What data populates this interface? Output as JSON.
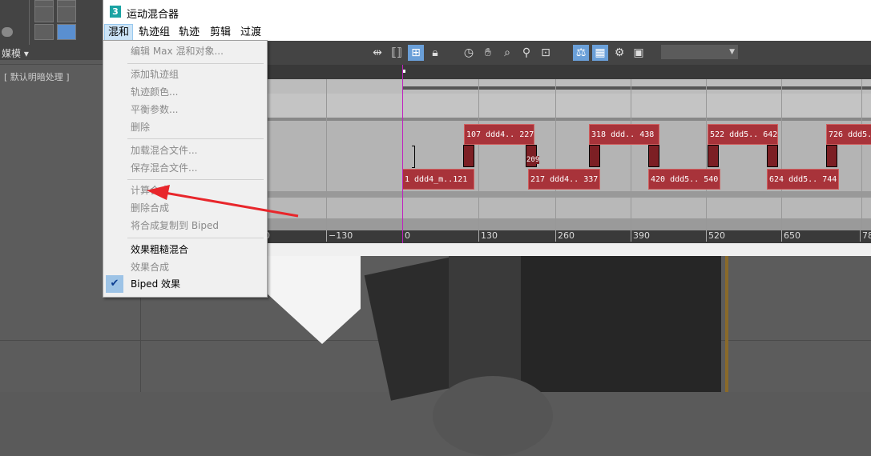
{
  "background": {
    "dropdown_label": "媒模",
    "viewport_label": "[ 默认明暗处理 ]"
  },
  "window": {
    "icon": "3",
    "title": "运动混合器"
  },
  "menubar": [
    "混和",
    "轨迹组",
    "轨迹",
    "剪辑",
    "过渡"
  ],
  "toolbar": {
    "icons": [
      "move-keys-icon",
      "fit-icon",
      "add-clip-icon",
      "lock-icon",
      "clock-icon",
      "hand-icon",
      "zoom-region-icon",
      "zoom-icon",
      "zoom-extents-icon",
      "balance-icon",
      "preview-icon",
      "settings-icon",
      "layout-icon"
    ],
    "combo_value": ""
  },
  "dropdown": {
    "items": [
      {
        "label": "编辑 Max 混和对象...",
        "enabled": false
      },
      {
        "label": "添加轨迹组",
        "enabled": false
      },
      {
        "label": "轨迹颜色...",
        "enabled": false
      },
      {
        "label": "平衡参数...",
        "enabled": false
      },
      {
        "label": "删除",
        "enabled": false
      },
      {
        "label": "加载混合文件...",
        "enabled": false
      },
      {
        "label": "保存混合文件...",
        "enabled": false
      },
      {
        "label": "计算合成",
        "enabled": false
      },
      {
        "label": "删除合成",
        "enabled": false
      },
      {
        "label": "将合成复制到 Biped",
        "enabled": false
      },
      {
        "label": "效果粗糙混合",
        "enabled": true
      },
      {
        "label": "效果合成",
        "enabled": false
      },
      {
        "label": "Biped 效果",
        "enabled": true,
        "checked": true
      }
    ]
  },
  "clips_top": [
    "107 ddd4.. 227",
    "318 ddd.. 438",
    "522 ddd5.. 642",
    "726 ddd5."
  ],
  "clips_bottom": [
    "1  ddd4_m..121",
    "217 ddd4.. 337",
    "420 ddd5.. 540",
    "624 ddd5.. 744"
  ],
  "transition_label": "209",
  "ruler": [
    "0",
    "−130",
    "0",
    "130",
    "260",
    "390",
    "520",
    "650",
    "78"
  ],
  "colors": {
    "clip": "#a8333a",
    "accent": "#6a9fd8",
    "arrow": "#e8262b"
  }
}
